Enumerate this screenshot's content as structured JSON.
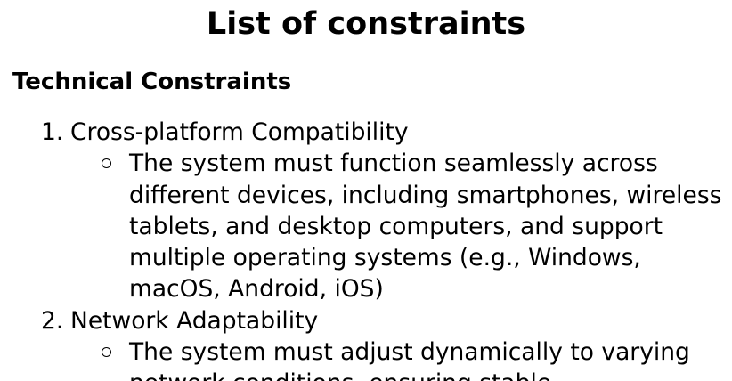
{
  "document": {
    "title": "List of constraints",
    "section_heading": "Technical Constraints",
    "items": [
      {
        "number": "1.",
        "label": "Cross-platform Compatibility",
        "detail": "The system must function seamlessly across different devices, including smartphones, wireless tablets, and desktop computers, and support multiple operating systems (e.g., Windows, macOS, Android, iOS)"
      },
      {
        "number": "2.",
        "label": "Network Adaptability",
        "detail": "The system must adjust dynamically to varying network conditions, ensuring stable"
      }
    ]
  }
}
